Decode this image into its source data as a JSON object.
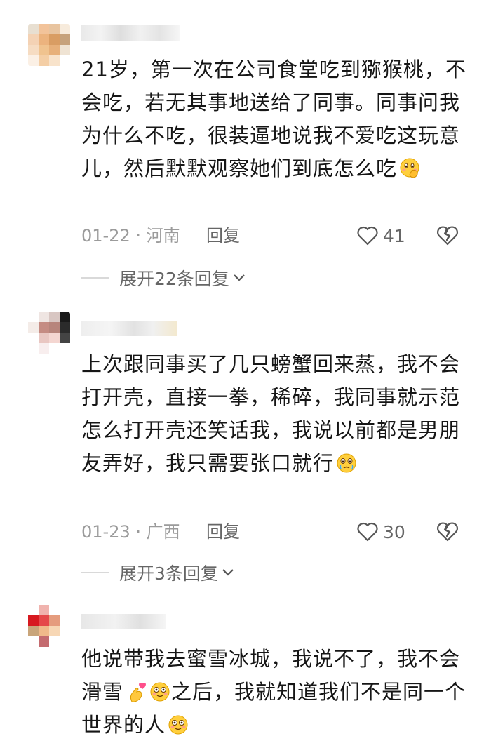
{
  "comments": [
    {
      "username": "",
      "text": "21岁，第一次在公司食堂吃到猕猴桃，不会吃，若无其事地送给了同事。同事问我为什么不吃，很装逼地说我不爱吃这玩意儿，然后默默观察她们到底怎么吃",
      "emoji": "smiling-hand-over-mouth-emoji",
      "date_location": "01-22 · 河南",
      "reply_label": "回复",
      "likes": "41",
      "expand_label": "展开22条回复"
    },
    {
      "username": "",
      "text": "上次跟同事买了几只螃蟹回来蒸，我不会打开壳，直接一拳，稀碎，我同事就示范怎么打开壳还笑话我，我说以前都是男朋友弄好，我只需要张口就行",
      "emoji": "holding-back-tears-emoji",
      "date_location": "01-23 · 广西",
      "reply_label": "回复",
      "likes": "30",
      "expand_label": "展开3条回复"
    },
    {
      "username": "",
      "text_part1": "他说带我去蜜雪冰城，我说不了，我不会滑雪",
      "text_part2": "之后，我就知道我们不是同一个世界的人",
      "emoji_heart": "finger-heart-emoji",
      "emoji_face": "flushed-face-emoji"
    }
  ],
  "colors": {
    "text": "#161616",
    "meta": "#9b9b9b",
    "divider": "#d9d9d9"
  }
}
